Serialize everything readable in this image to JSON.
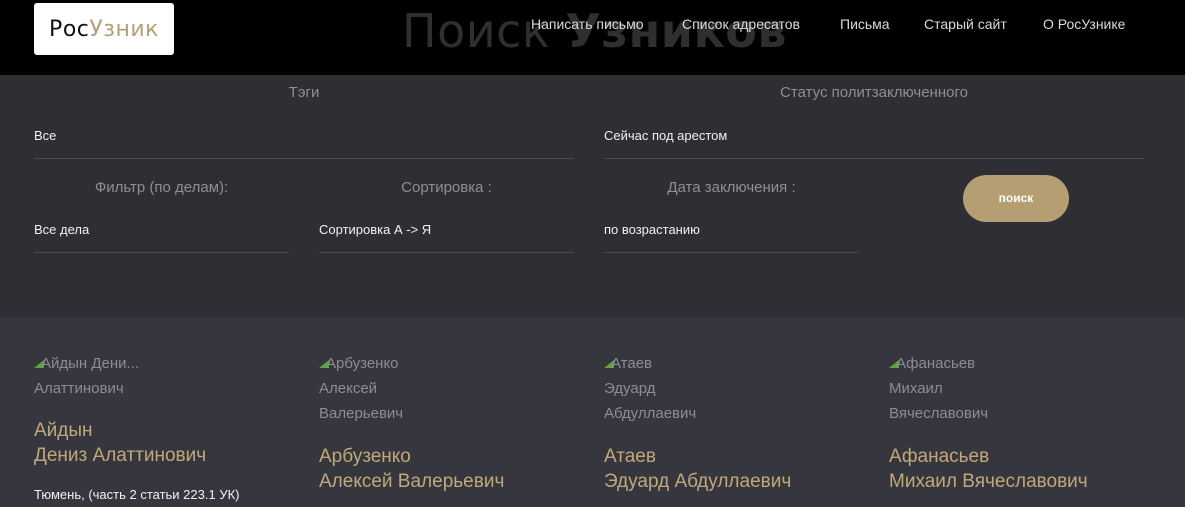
{
  "header": {
    "logo": {
      "part1": "Рос",
      "part2": "Узник"
    },
    "hero_title": {
      "part1": "Поиск ",
      "part2": "Узников"
    },
    "nav": [
      "Написать письмо",
      "Список адресатов",
      "Письма",
      "Старый сайт",
      "О РосУзнике"
    ]
  },
  "filters": {
    "tags": {
      "label": "Тэги",
      "value": "Все"
    },
    "status": {
      "label": "Статус политзаключенного",
      "value": "Сейчас под арестом"
    },
    "cases": {
      "label": "Фильтр (по делам):",
      "value": "Все дела"
    },
    "sort": {
      "label": "Сортировка :",
      "value": "Сортировка А -> Я"
    },
    "date": {
      "label": "Дата заключения :",
      "value": "по возрастанию"
    },
    "search_button": "поиск"
  },
  "cards": [
    {
      "alt_lines": [
        "Айдын Дени...",
        "Алаттинович"
      ],
      "name_lines": [
        "Айдын",
        "Дениз Алаттинович"
      ],
      "location": "Тюмень, (часть 2 статьи 223.1 УК)"
    },
    {
      "alt_lines": [
        "Арбузенко",
        "Алексей",
        "Валерьевич"
      ],
      "name_lines": [
        "Арбузенко",
        "Алексей Валерьевич"
      ],
      "location": ""
    },
    {
      "alt_lines": [
        "Атаев",
        "Эдуард",
        "Абдуллаевич"
      ],
      "name_lines": [
        "Атаев",
        "Эдуард Абдуллаевич"
      ],
      "location": ""
    },
    {
      "alt_lines": [
        "Афанасьев",
        "Михаил",
        "Вячеславович"
      ],
      "name_lines": [
        "Афанасьев",
        "Михаил Вячеславович"
      ],
      "location": ""
    }
  ]
}
